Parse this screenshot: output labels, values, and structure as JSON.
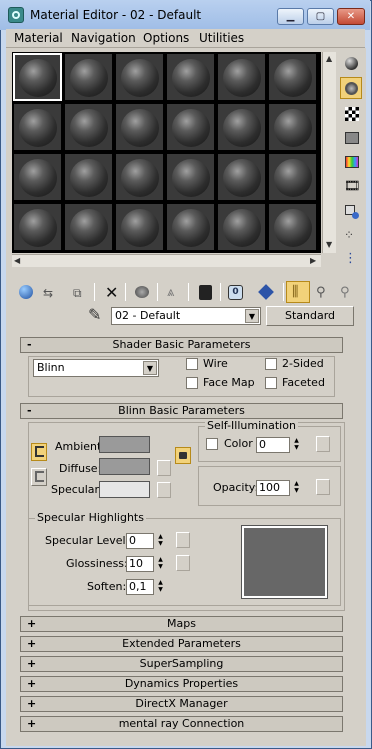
{
  "window": {
    "title": "Material Editor - 02 - Default"
  },
  "title_buttons": {
    "minimize": "▁",
    "maximize": "▢",
    "close": "✕"
  },
  "menu": [
    "Material",
    "Navigation",
    "Options",
    "Utilities"
  ],
  "material_name": "02 - Default",
  "material_type": "Standard",
  "shader_basic": {
    "title": "Shader Basic Parameters",
    "sign": "-",
    "shader": "Blinn",
    "options": [
      {
        "label": "Wire"
      },
      {
        "label": "2-Sided"
      },
      {
        "label": "Face Map"
      },
      {
        "label": "Faceted"
      }
    ]
  },
  "blinn_basic": {
    "title": "Blinn Basic Parameters",
    "sign": "-",
    "ambient_label": "Ambient:",
    "diffuse_label": "Diffuse:",
    "specular_label": "Specular:",
    "self_illum_title": "Self-Illumination",
    "color_label": "Color",
    "self_illum_value": "0",
    "opacity_label": "Opacity:",
    "opacity_value": "100",
    "spec_title": "Specular Highlights",
    "spec_level_label": "Specular Level:",
    "spec_level_value": "0",
    "glossiness_label": "Glossiness:",
    "glossiness_value": "10",
    "soften_label": "Soften:",
    "soften_value": "0,1"
  },
  "collapsed_rollouts": [
    {
      "sign": "+",
      "title": "Maps"
    },
    {
      "sign": "+",
      "title": "Extended Parameters"
    },
    {
      "sign": "+",
      "title": "SuperSampling"
    },
    {
      "sign": "+",
      "title": "Dynamics Properties"
    },
    {
      "sign": "+",
      "title": "DirectX Manager"
    },
    {
      "sign": "+",
      "title": "mental ray Connection"
    }
  ],
  "colors": {
    "ambient": "#9a9a9a",
    "diffuse": "#9a9a9a",
    "specular": "#e6e6e6",
    "highlight_preview": "#676767",
    "active_toggle": "#f2d27a"
  },
  "slot_count": 24,
  "selected_slot": 0
}
